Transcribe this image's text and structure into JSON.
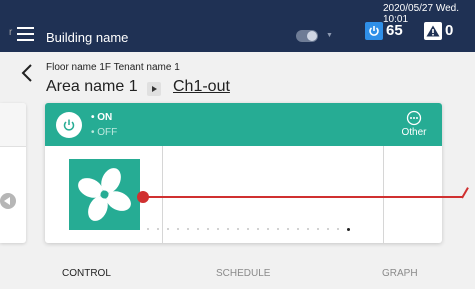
{
  "header": {
    "building_name": "Building name",
    "datetime": "2020/05/27 Wed. 10:01",
    "power_count": "65",
    "alert_count": "0"
  },
  "breadcrumb": {
    "floor_tenant": "Floor name 1F Tenant name 1",
    "area_name": "Area name 1",
    "channel": "Ch1-out"
  },
  "peek_card": {
    "partial_text": "r"
  },
  "card": {
    "on_label": "• ON",
    "off_label": "• OFF",
    "other_label": "Other",
    "icon": "fan-icon"
  },
  "tabs": [
    {
      "label": "CONTROL"
    },
    {
      "label": "SCHEDULE"
    },
    {
      "label": "GRAPH"
    }
  ],
  "colors": {
    "header_bg": "#1f3154",
    "accent_teal": "#26ac94",
    "power_blue": "#2f8fe8",
    "annotation_red": "#d03030"
  }
}
